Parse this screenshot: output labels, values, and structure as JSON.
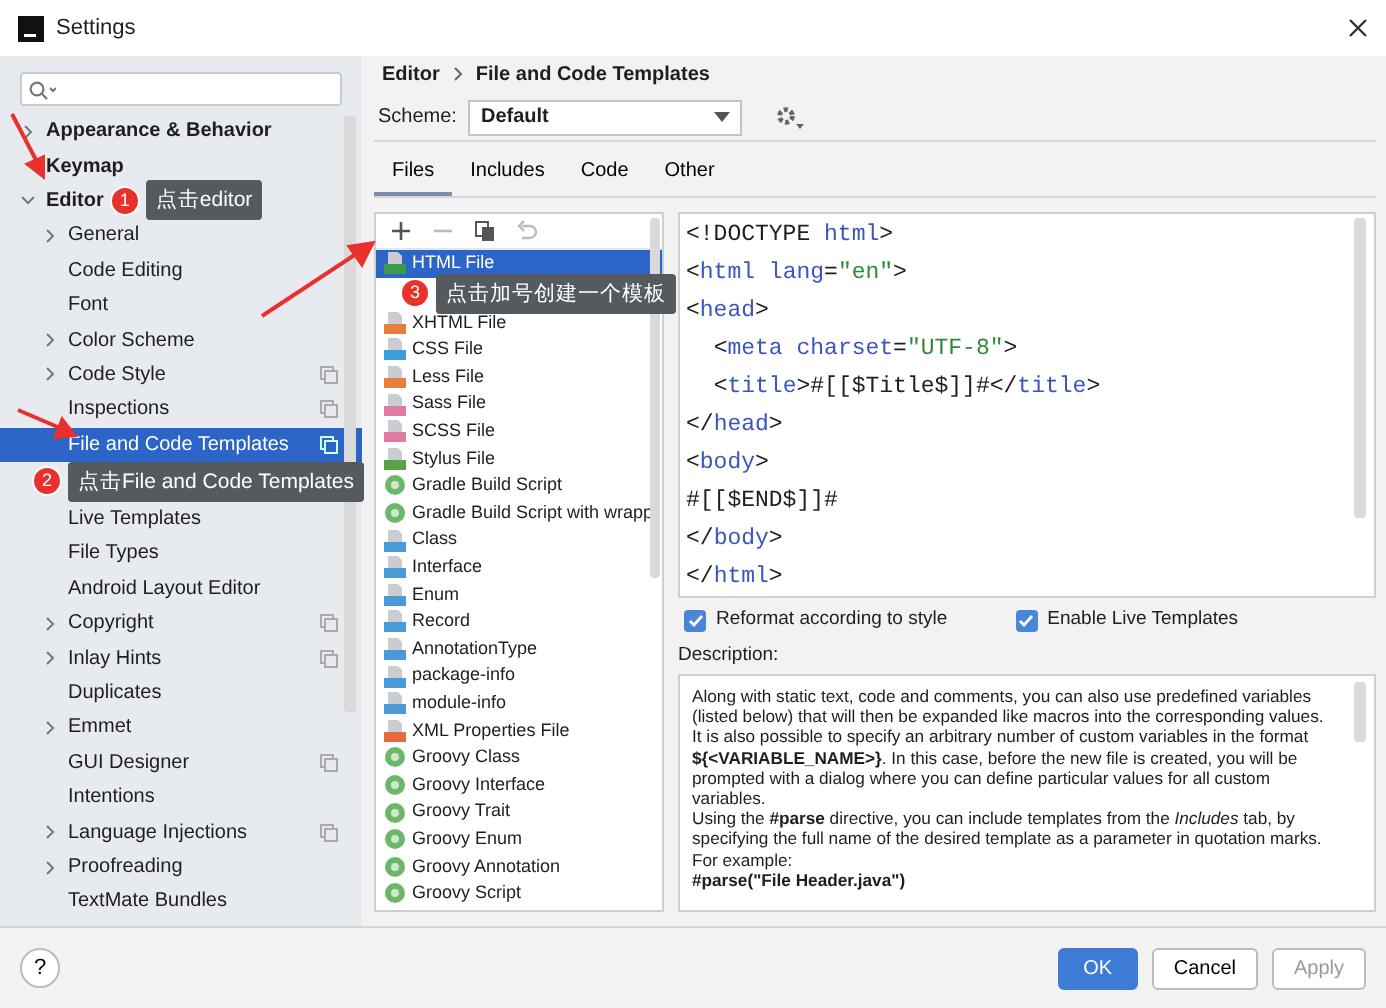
{
  "window": {
    "title": "Settings"
  },
  "sidebar": {
    "items": [
      {
        "label": "Appearance & Behavior",
        "kind": "group",
        "expanded": false,
        "selected": false
      },
      {
        "label": "Keymap",
        "kind": "leaf",
        "selected": false
      },
      {
        "label": "Editor",
        "kind": "group",
        "expanded": true,
        "selected": false,
        "callout": {
          "number": "1",
          "text": "点击editor"
        },
        "children": [
          {
            "label": "General",
            "kind": "group",
            "expanded": false,
            "selected": false,
            "scoped": false
          },
          {
            "label": "Code Editing",
            "kind": "leaf",
            "selected": false,
            "scoped": false
          },
          {
            "label": "Font",
            "kind": "leaf",
            "selected": false,
            "scoped": false
          },
          {
            "label": "Color Scheme",
            "kind": "group",
            "expanded": false,
            "selected": false,
            "scoped": false
          },
          {
            "label": "Code Style",
            "kind": "group",
            "expanded": false,
            "selected": false,
            "scoped": true
          },
          {
            "label": "Inspections",
            "kind": "leaf",
            "selected": false,
            "scoped": true
          },
          {
            "label": "File and Code Templates",
            "kind": "leaf",
            "selected": true,
            "scoped": true
          },
          {
            "kind": "callout",
            "number": "2",
            "text": "点击File and Code Templates"
          },
          {
            "label": "Live Templates",
            "kind": "leaf",
            "selected": false,
            "scoped": false
          },
          {
            "label": "File Types",
            "kind": "leaf",
            "selected": false,
            "scoped": false
          },
          {
            "label": "Android Layout Editor",
            "kind": "leaf",
            "selected": false,
            "scoped": false
          },
          {
            "label": "Copyright",
            "kind": "group",
            "expanded": false,
            "selected": false,
            "scoped": true
          },
          {
            "label": "Inlay Hints",
            "kind": "group",
            "expanded": false,
            "selected": false,
            "scoped": true
          },
          {
            "label": "Duplicates",
            "kind": "leaf",
            "selected": false,
            "scoped": false
          },
          {
            "label": "Emmet",
            "kind": "group",
            "expanded": false,
            "selected": false,
            "scoped": false
          },
          {
            "label": "GUI Designer",
            "kind": "leaf",
            "selected": false,
            "scoped": true
          },
          {
            "label": "Intentions",
            "kind": "leaf",
            "selected": false,
            "scoped": false
          },
          {
            "label": "Language Injections",
            "kind": "group",
            "expanded": false,
            "selected": false,
            "scoped": true
          },
          {
            "label": "Proofreading",
            "kind": "group",
            "expanded": false,
            "selected": false,
            "scoped": false
          },
          {
            "label": "TextMate Bundles",
            "kind": "leaf",
            "selected": false,
            "scoped": false
          }
        ]
      }
    ]
  },
  "breadcrumb": [
    "Editor",
    "File and Code Templates"
  ],
  "scheme": {
    "label": "Scheme:",
    "value": "Default"
  },
  "tabs": [
    {
      "label": "Files",
      "selected": true
    },
    {
      "label": "Includes",
      "selected": false
    },
    {
      "label": "Code",
      "selected": false
    },
    {
      "label": "Other",
      "selected": false
    }
  ],
  "templates": {
    "toolbar": [
      {
        "kind": "add",
        "disabled": false
      },
      {
        "kind": "remove",
        "disabled": true
      },
      {
        "kind": "copy",
        "disabled": false
      },
      {
        "kind": "revert",
        "disabled": true
      }
    ],
    "items": [
      {
        "kind": "html",
        "label": "HTML File",
        "selected": true
      },
      {
        "kind": "callout",
        "number": "3",
        "text": "点击加号创建一个模板"
      },
      {
        "kind": "xhtml",
        "label": "XHTML File",
        "selected": false
      },
      {
        "kind": "css",
        "label": "CSS File",
        "selected": false
      },
      {
        "kind": "less",
        "label": "Less File",
        "selected": false
      },
      {
        "kind": "sass",
        "label": "Sass File",
        "selected": false
      },
      {
        "kind": "sass",
        "label": "SCSS File",
        "selected": false
      },
      {
        "kind": "stylus",
        "label": "Stylus File",
        "selected": false
      },
      {
        "kind": "groovy",
        "label": "Gradle Build Script",
        "selected": false
      },
      {
        "kind": "groovy",
        "label": "Gradle Build Script with wrapp",
        "selected": false
      },
      {
        "kind": "java",
        "label": "Class",
        "selected": false
      },
      {
        "kind": "java",
        "label": "Interface",
        "selected": false
      },
      {
        "kind": "java",
        "label": "Enum",
        "selected": false
      },
      {
        "kind": "java",
        "label": "Record",
        "selected": false
      },
      {
        "kind": "java",
        "label": "AnnotationType",
        "selected": false
      },
      {
        "kind": "java",
        "label": "package-info",
        "selected": false
      },
      {
        "kind": "java",
        "label": "module-info",
        "selected": false
      },
      {
        "kind": "xml",
        "label": "XML Properties File",
        "selected": false
      },
      {
        "kind": "groovy",
        "label": "Groovy Class",
        "selected": false
      },
      {
        "kind": "groovy",
        "label": "Groovy Interface",
        "selected": false
      },
      {
        "kind": "groovy",
        "label": "Groovy Trait",
        "selected": false
      },
      {
        "kind": "groovy",
        "label": "Groovy Enum",
        "selected": false
      },
      {
        "kind": "groovy",
        "label": "Groovy Annotation",
        "selected": false
      },
      {
        "kind": "groovy",
        "label": "Groovy Script",
        "selected": false
      }
    ]
  },
  "code_lines": [
    "<!DOCTYPE html>",
    "<html lang=\"en\">",
    "<head>",
    "  <meta charset=\"UTF-8\">",
    "  <title>#[[$Title$]]#</title>",
    "</head>",
    "<body>",
    "#[[$END$]]#",
    "</body>",
    "</html>"
  ],
  "options": [
    {
      "label": "Reformat according to style",
      "checked": true
    },
    {
      "label": "Enable Live Templates",
      "checked": true
    }
  ],
  "description": {
    "label": "Description:",
    "paragraphs": [
      {
        "kind": "text",
        "text": "Along with static text, code and comments, you can also use predefined variables (listed below) that will then be expanded like macros into the corresponding values."
      },
      {
        "kind": "text",
        "text": "It is also possible to specify an arbitrary number of custom variables in the format **${<VARIABLE_NAME>}**. In this case, before the new file is created, you will be prompted with a dialog where you can define particular values for all custom variables."
      },
      {
        "kind": "text",
        "text": "Using the **#parse** directive, you can include templates from the *Includes* tab, by specifying the full name of the desired template as a parameter in quotation marks. For example:"
      },
      {
        "kind": "example",
        "text": "#parse(\"File Header.java\")"
      }
    ]
  },
  "help": {
    "label": "?"
  },
  "buttons": [
    {
      "label": "OK",
      "kind": "primary",
      "disabled": false
    },
    {
      "label": "Cancel",
      "kind": "secondary",
      "disabled": false
    },
    {
      "label": "Apply",
      "kind": "secondary",
      "disabled": true
    }
  ]
}
